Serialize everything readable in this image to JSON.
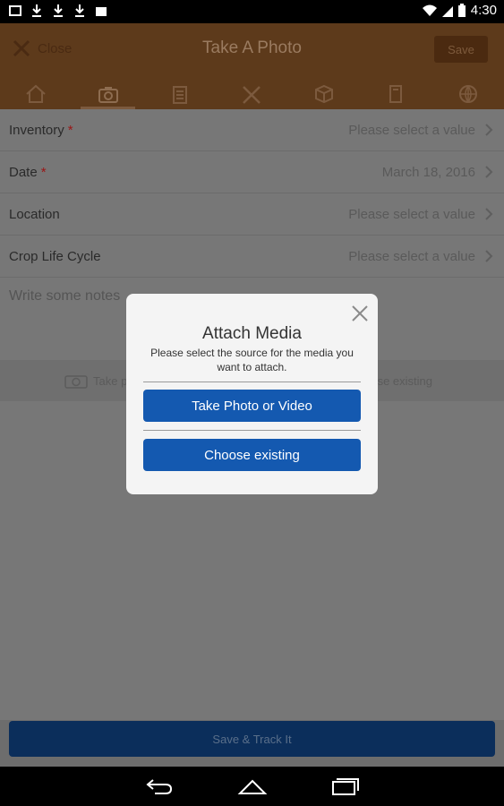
{
  "status_bar": {
    "time": "4:30"
  },
  "app_bar": {
    "close_label": "Close",
    "title": "Take A Photo",
    "save_label": "Save",
    "tabs": [
      "home",
      "camera",
      "clipboard",
      "tools",
      "box",
      "note",
      "globe"
    ]
  },
  "form": {
    "rows": [
      {
        "label": "Inventory",
        "required": true,
        "value": "Please select a value"
      },
      {
        "label": "Date",
        "required": true,
        "value": "March 18, 2016"
      },
      {
        "label": "Location",
        "required": false,
        "value": "Please select a value"
      },
      {
        "label": "Crop Life Cycle",
        "required": false,
        "value": "Please select a value"
      }
    ],
    "notes_placeholder": "Write some notes",
    "attach_left": "Take p",
    "attach_right": "se existing"
  },
  "dialog": {
    "title": "Attach Media",
    "message": "Please select the source for the media you want to attach.",
    "primary_button": "Take Photo or Video",
    "secondary_button": "Choose existing"
  },
  "footer": {
    "save_track_label": "Save & Track It"
  },
  "colors": {
    "accent_blue": "#1459b0",
    "app_bar_brown": "#5d3a1b",
    "required_red": "#9b1616"
  }
}
